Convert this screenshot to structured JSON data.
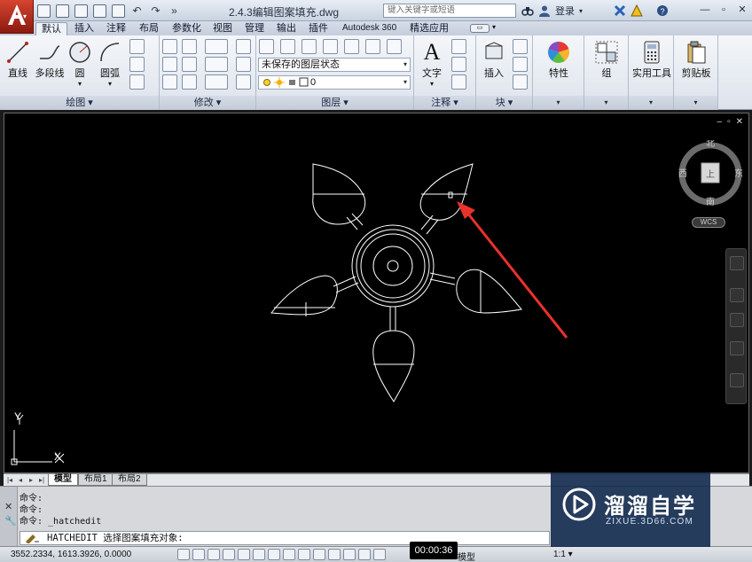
{
  "title_bar": {
    "document_title": "2.4.3编辑图案填充.dwg",
    "search_placeholder": "键入关键字或短语",
    "login_label": "登录",
    "window_buttons": [
      "—",
      "▫",
      "✕"
    ]
  },
  "ribbon_tabs": [
    "默认",
    "插入",
    "注释",
    "布局",
    "参数化",
    "视图",
    "管理",
    "输出",
    "插件",
    "Autodesk 360",
    "精选应用"
  ],
  "active_tab": "默认",
  "ribbon": {
    "draw_panel": {
      "label": "绘图 ▾",
      "tools": [
        "直线",
        "多段线",
        "圆",
        "圆弧"
      ]
    },
    "modify_panel": {
      "label": "修改 ▾"
    },
    "layers_panel": {
      "label": "图层 ▾",
      "layer_state": "未保存的图层状态",
      "current_layer": "0"
    },
    "annotation_panel": {
      "label": "注释 ▾",
      "text_tool": "文字"
    },
    "block_panel": {
      "label": "块 ▾",
      "insert_tool": "插入"
    },
    "properties_tool": "特性",
    "group_tool": "组",
    "utilities_tool": "实用工具",
    "clipboard_tool": "剪贴板"
  },
  "viewcube": {
    "north": "北",
    "south": "南",
    "east": "东",
    "west": "西",
    "wcs": "WCS"
  },
  "ucs": {
    "x": "X",
    "y": "Y"
  },
  "layout_tabs": [
    "模型",
    "布局1",
    "布局2"
  ],
  "active_layout": "模型",
  "command_window": {
    "history": [
      "命令:",
      "命令:",
      "命令: _hatchedit"
    ],
    "current": "HATCHEDIT 选择图案填充对象:"
  },
  "status_bar": {
    "coordinates": "3552.2334, 1613.3926, 0.0000",
    "model_label": "模型",
    "scale": "1:1 ▾"
  },
  "timer": "00:00:36",
  "watermark": {
    "name": "溜溜自学",
    "url": "ZIXUE.3D66.COM"
  },
  "colors": {
    "app_red": "#c0392b",
    "annotation_arrow": "#e8322b",
    "canvas_bg": "#000000",
    "drawing_lines": "#ffffff"
  }
}
